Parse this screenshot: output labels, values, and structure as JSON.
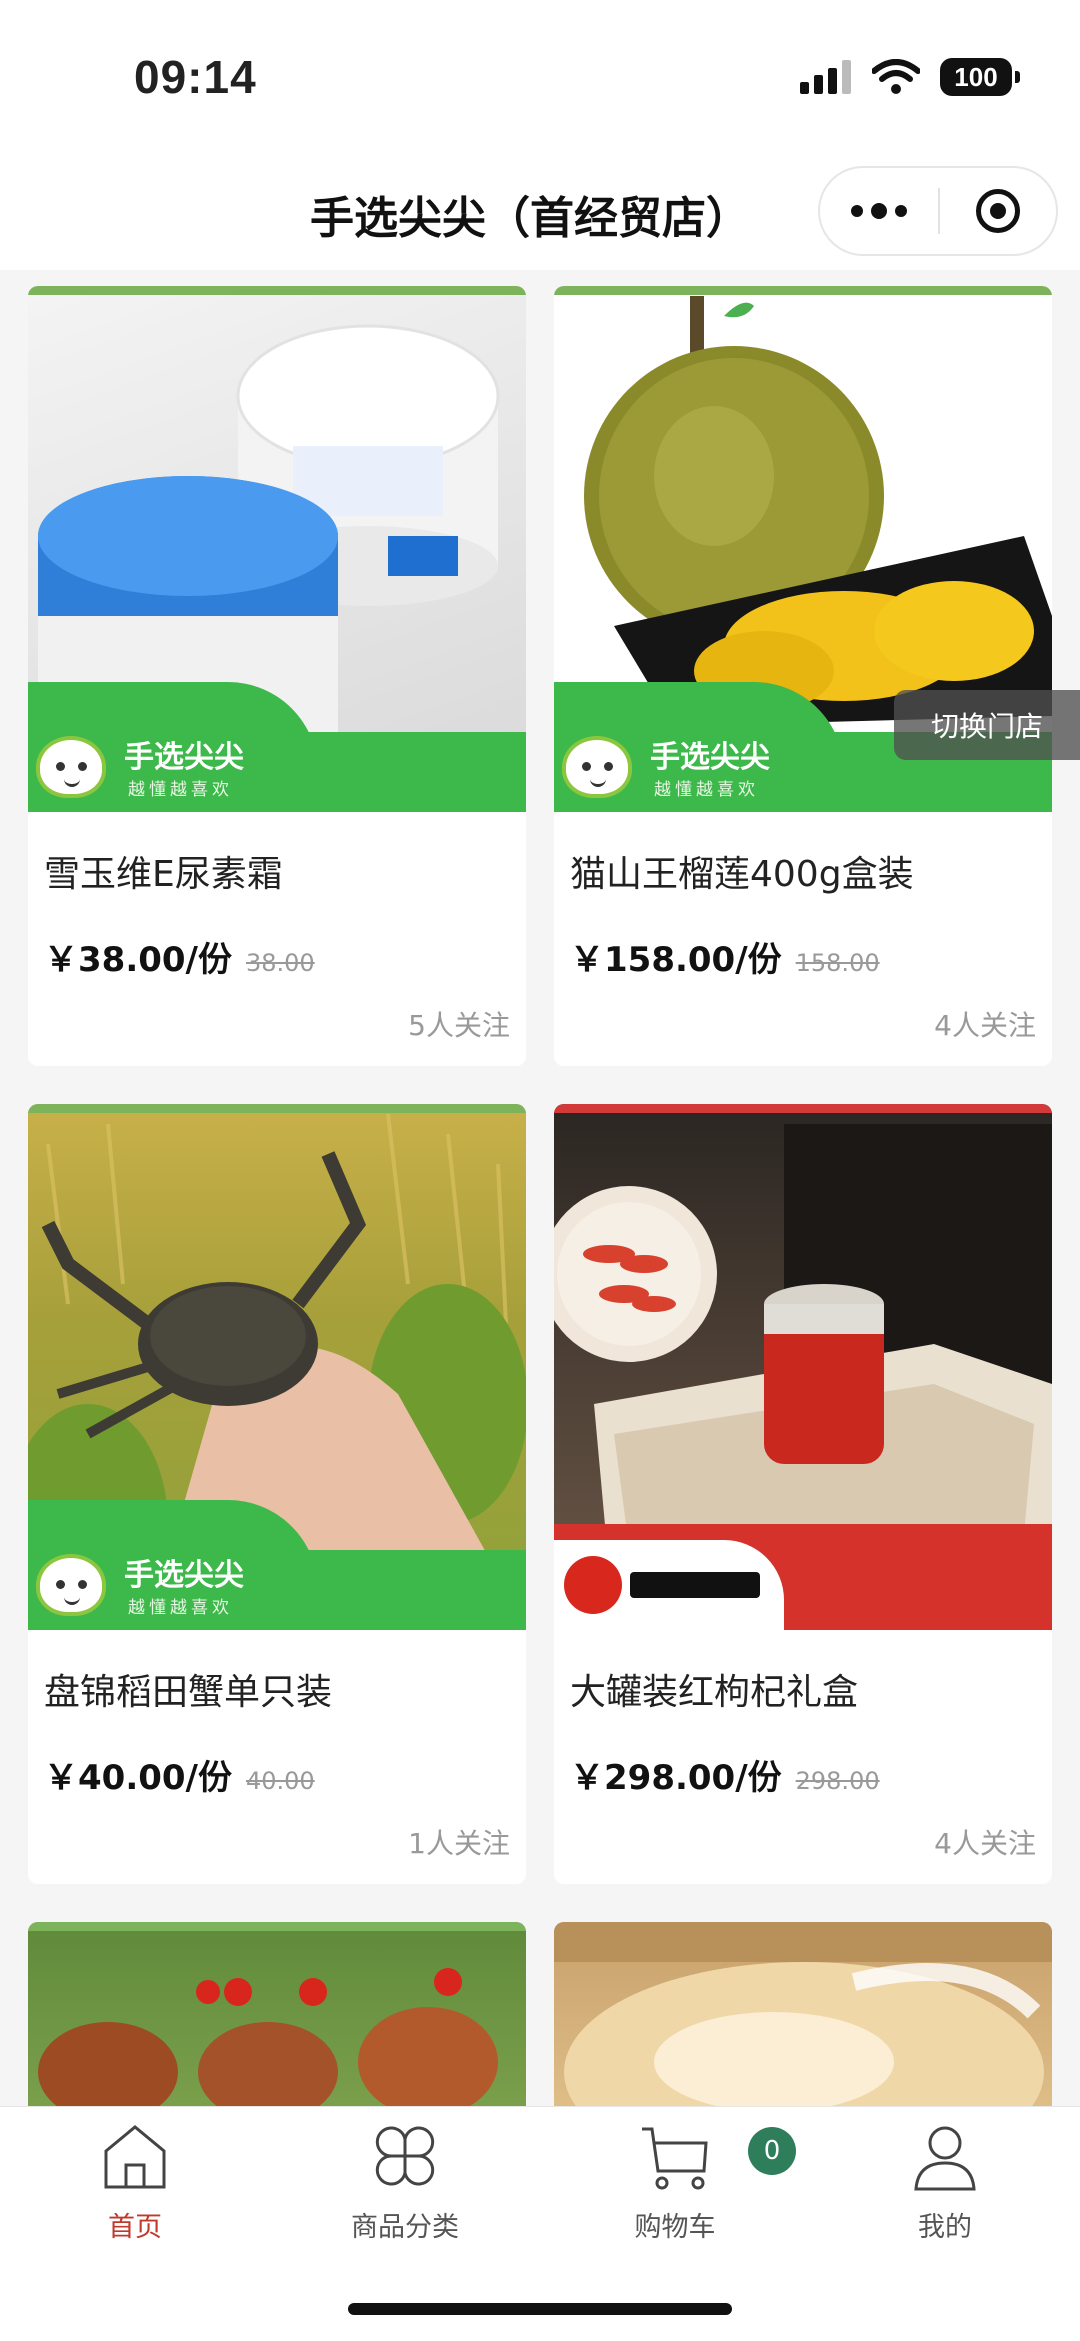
{
  "status_bar": {
    "time": "09:14",
    "battery": "100"
  },
  "nav": {
    "title": "手选尖尖（首经贸店）"
  },
  "brand": {
    "name": "手选尖尖",
    "slogan": "越懂越喜欢"
  },
  "float_button": {
    "label": "切换门店"
  },
  "products": [
    {
      "name": "雪玉维E尿素霜",
      "price": "￥38.00/份",
      "original_price": "38.00",
      "followers": "5人关注"
    },
    {
      "name": "猫山王榴莲400g盒装",
      "price": "￥158.00/份",
      "original_price": "158.00",
      "followers": "4人关注"
    },
    {
      "name": "盘锦稻田蟹单只装",
      "price": "￥40.00/份",
      "original_price": "40.00",
      "followers": "1人关注"
    },
    {
      "name": "大罐装红枸杞礼盒",
      "price": "￥298.00/份",
      "original_price": "298.00",
      "followers": "4人关注"
    }
  ],
  "tabs": [
    {
      "label": "首页",
      "icon": "home-icon",
      "active": true
    },
    {
      "label": "商品分类",
      "icon": "category-icon",
      "active": false
    },
    {
      "label": "购物车",
      "icon": "cart-icon",
      "active": false
    },
    {
      "label": "我的",
      "icon": "user-icon",
      "active": false
    }
  ],
  "cart_badge": "0",
  "colors": {
    "brand_green": "#3cb94a",
    "active_tab": "#c0392b",
    "badge": "#2e7d5b"
  }
}
